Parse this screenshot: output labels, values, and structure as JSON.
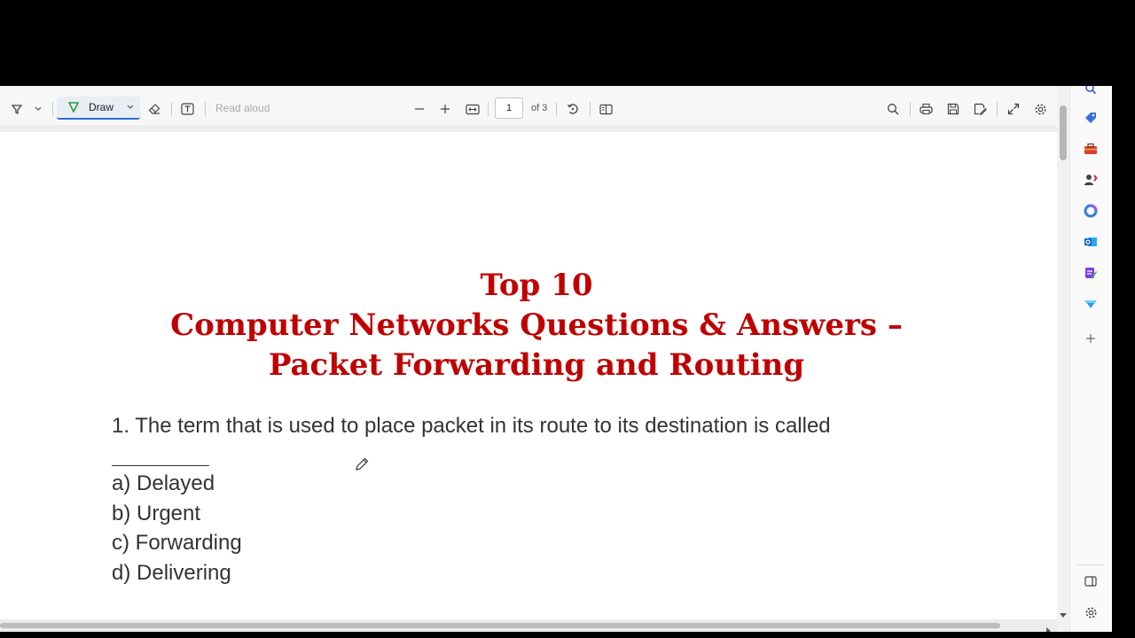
{
  "toolbar": {
    "draw_label": "Draw",
    "read_aloud": "Read aloud",
    "page_current": "1",
    "page_total": "of 3"
  },
  "document": {
    "title_lines": [
      "Top 10",
      "Computer Networks Questions & Answers –",
      "Packet Forwarding and Routing"
    ],
    "question": "1. The term that is used to place packet in its route to its destination is called",
    "options": [
      "a) Delayed",
      "b) Urgent",
      "c) Forwarding",
      "d) Delivering"
    ]
  },
  "colors": {
    "title": "#c00000",
    "accent": "#2f6fd6"
  },
  "icons": {
    "toolbar": [
      "highlight-icon",
      "chevron-down-icon",
      "draw-icon",
      "eraser-icon",
      "text-box-icon",
      "zoom-out-icon",
      "zoom-in-icon",
      "fit-page-icon",
      "rotate-icon",
      "page-view-icon",
      "search-icon",
      "print-icon",
      "save-icon",
      "save-as-icon",
      "fullscreen-icon",
      "settings-icon"
    ],
    "sidebar": [
      "search-icon",
      "tag-icon",
      "toolbox-icon",
      "people-icon",
      "copilot-icon",
      "outlook-icon",
      "designer-icon",
      "drop-icon",
      "add-icon",
      "sidebar-toggle-icon",
      "settings-icon"
    ]
  }
}
